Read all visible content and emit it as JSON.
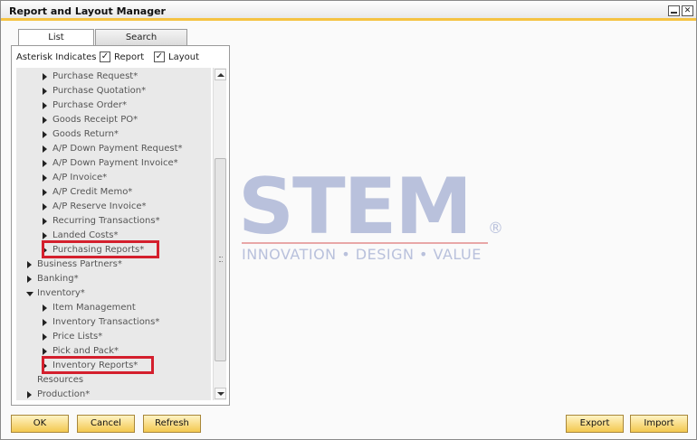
{
  "window": {
    "title": "Report and Layout Manager",
    "minimize_glyph": "",
    "close_glyph": "✕"
  },
  "tabs": [
    {
      "label": "List",
      "active": true
    },
    {
      "label": "Search",
      "active": false
    }
  ],
  "options": {
    "asterisk_label": "Asterisk Indicates",
    "report_label": "Report",
    "report_checked": "✓",
    "layout_label": "Layout",
    "layout_checked": "✓"
  },
  "tree": [
    {
      "label": "Purchase Request*",
      "expander": "collapsed"
    },
    {
      "label": "Purchase Quotation*",
      "expander": "collapsed"
    },
    {
      "label": "Purchase Order*",
      "expander": "collapsed"
    },
    {
      "label": "Goods Receipt PO*",
      "expander": "collapsed"
    },
    {
      "label": "Goods Return*",
      "expander": "collapsed"
    },
    {
      "label": "A/P Down Payment Request*",
      "expander": "collapsed"
    },
    {
      "label": "A/P Down Payment Invoice*",
      "expander": "collapsed"
    },
    {
      "label": "A/P Invoice*",
      "expander": "collapsed"
    },
    {
      "label": "A/P Credit Memo*",
      "expander": "collapsed"
    },
    {
      "label": "A/P Reserve Invoice*",
      "expander": "collapsed"
    },
    {
      "label": "Recurring Transactions*",
      "expander": "collapsed"
    },
    {
      "label": "Landed Costs*",
      "expander": "collapsed"
    },
    {
      "label": "Purchasing Reports*",
      "expander": "collapsed",
      "highlighted": true
    },
    {
      "label": "Business Partners*",
      "expander": "collapsed"
    },
    {
      "label": "Banking*",
      "expander": "collapsed"
    },
    {
      "label": "Inventory*",
      "expander": "expanded"
    },
    {
      "label": "Item Management",
      "expander": "collapsed"
    },
    {
      "label": "Inventory Transactions*",
      "expander": "collapsed"
    },
    {
      "label": "Price Lists*",
      "expander": "collapsed"
    },
    {
      "label": "Pick and Pack*",
      "expander": "collapsed"
    },
    {
      "label": "Inventory Reports*",
      "expander": "collapsed",
      "highlighted": true
    },
    {
      "label": "Resources",
      "expander": "none"
    },
    {
      "label": "Production*",
      "expander": "collapsed"
    }
  ],
  "watermark": {
    "text": "STEM",
    "registered": "®",
    "tagline": "INNOVATION • DESIGN • VALUE"
  },
  "buttons": {
    "ok": "OK",
    "cancel": "Cancel",
    "refresh": "Refresh",
    "export": "Export",
    "import": "Import"
  },
  "colors": {
    "title_accent": "#f5c342",
    "button_fill": "#f3c84f",
    "highlight_box": "#d41f2d",
    "tree_background": "#e9e9e9"
  }
}
